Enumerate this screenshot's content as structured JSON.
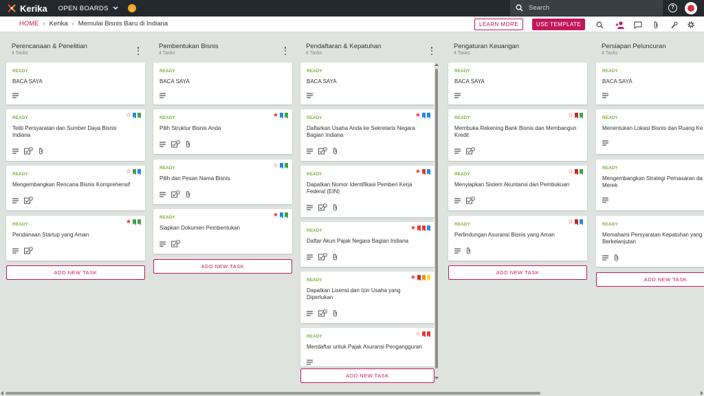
{
  "app": {
    "name": "Kerika",
    "open_boards": "OPEN BOARDS"
  },
  "search": {
    "placeholder": "Search"
  },
  "breadcrumb": {
    "home": "HOME",
    "level1": "Kerika",
    "current": "Memulai Bisnis Baru di Indiana"
  },
  "actions": {
    "learn_more": "LEARN MORE",
    "use_template": "USE TEMPLATE"
  },
  "toolbar_icons": [
    "search-icon",
    "add-person-icon",
    "chat-icon",
    "attachment-icon",
    "wrench-icon",
    "settings-icon"
  ],
  "colors": {
    "accent": "#c2185b",
    "ready": "#7cb342",
    "topbar": "#24292e",
    "flag_red": "#e53935",
    "flag_blue": "#1e88e5",
    "flag_green": "#43a047",
    "flag_orange": "#fb8c00",
    "flag_yellow": "#fdd835",
    "flag_darkred": "#c62828"
  },
  "add_task_label": "ADD NEW TASK",
  "columns": [
    {
      "title": "Perencanaan & Penelitian",
      "count": "4 Tasks",
      "cards": [
        {
          "status": "READY",
          "title": "BACA SAYA"
        },
        {
          "status": "READY",
          "title": "Teliti Persyaratan dan Sumber Daya Bisnis Indiana",
          "checklist": "0"
        },
        {
          "status": "READY",
          "title": "Mengembangkan Rencana Bisnis Komprehensif",
          "checklist": "0"
        },
        {
          "status": "READY",
          "title": "Pendanaan Startup yang Aman",
          "checklist": "0"
        }
      ]
    },
    {
      "title": "Pembentukan Bisnis",
      "count": "4 Tasks",
      "cards": [
        {
          "status": "READY",
          "title": "BACA SAYA"
        },
        {
          "status": "READY",
          "title": "Pilih Struktur Bisnis Anda",
          "checklist": "0"
        },
        {
          "status": "READY",
          "title": "Pilih dan Pesan Nama Bisnis",
          "checklist": "0"
        },
        {
          "status": "READY",
          "title": "Siapkan Dokumen Pembentukan",
          "checklist": "0"
        }
      ]
    },
    {
      "title": "Pendaftaran & Kepatuhan",
      "count": "6 Tasks",
      "cards": [
        {
          "status": "READY",
          "title": "BACA SAYA"
        },
        {
          "status": "READY",
          "title": "Daftarkan Usaha Anda ke Sekretaris Negara Bagian Indiana",
          "checklist": "0"
        },
        {
          "status": "READY",
          "title": "Dapatkan Nomor Identifikasi Pemberi Kerja Federal (EIN)",
          "checklist": "0"
        },
        {
          "status": "READY",
          "title": "Daftar Akun Pajak Negara Bagian Indiana",
          "checklist": "0"
        },
        {
          "status": "READY",
          "title": "Dapatkan Lisensi dan Izin Usaha yang Diperlukan",
          "checklist": "0"
        },
        {
          "status": "READY",
          "title": "Mendaftar untuk Pajak Asuransi Pengangguran"
        }
      ]
    },
    {
      "title": "Pengaturan Keuangan",
      "count": "4 Tasks",
      "cards": [
        {
          "status": "READY",
          "title": "BACA SAYA"
        },
        {
          "status": "READY",
          "title": "Membuka Rekening Bank Bisnis dan Membangun Kredit",
          "checklist": "0"
        },
        {
          "status": "READY",
          "title": "Menyiapkan Sistem Akuntansi dan Pembukuan",
          "checklist": "0"
        },
        {
          "status": "READY",
          "title": "Perlindungan Asuransi Bisnis yang Aman"
        }
      ]
    },
    {
      "title": "Persiapan Peluncuran",
      "count": "4 Tasks",
      "cards": [
        {
          "status": "READY",
          "title": "BACA SAYA"
        },
        {
          "status": "READY",
          "title": "Menentukan Lokasi Bisnis dan Ruang Ke"
        },
        {
          "status": "READY",
          "title": "Mengembangkan Strategi Pemasaran da Pencitraan Merek"
        },
        {
          "status": "READY",
          "title": "Memahami Persyaratan Kepatuhan yang Berkelanjutan"
        }
      ]
    }
  ]
}
